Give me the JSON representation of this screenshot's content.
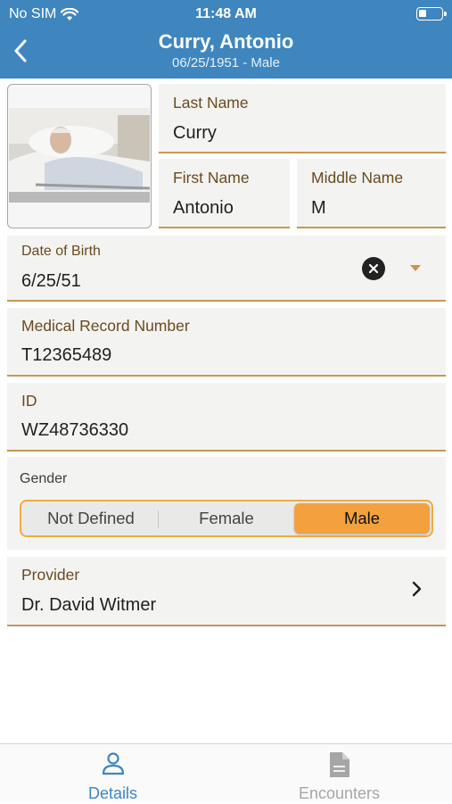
{
  "status_bar": {
    "carrier": "No SIM",
    "time": "11:48 AM"
  },
  "header": {
    "title": "Curry, Antonio",
    "subtitle": "06/25/1951 - Male"
  },
  "fields": {
    "last_name": {
      "label": "Last Name",
      "value": "Curry"
    },
    "first_name": {
      "label": "First Name",
      "value": "Antonio"
    },
    "middle_name": {
      "label": "Middle Name",
      "value": "M"
    },
    "date_of_birth": {
      "label": "Date of Birth",
      "value": "6/25/51"
    },
    "medical_record_number": {
      "label": "Medical Record Number",
      "value": "T12365489"
    },
    "id": {
      "label": "ID",
      "value": "WZ48736330"
    },
    "provider": {
      "label": "Provider",
      "value": "Dr. David Witmer"
    }
  },
  "gender": {
    "label": "Gender",
    "options": [
      "Not Defined",
      "Female",
      "Male"
    ],
    "selected": "Male"
  },
  "tabs": [
    {
      "label": "Details",
      "icon": "person-icon",
      "active": true
    },
    {
      "label": "Encounters",
      "icon": "document-icon",
      "active": false
    }
  ],
  "colors": {
    "header_bg": "#3f86bf",
    "accent": "#f3a13f",
    "field_underline": "#c89650",
    "label_brown": "#6b4a1e",
    "active_tab": "#3f86bf",
    "inactive_tab": "#a6a6a6"
  }
}
